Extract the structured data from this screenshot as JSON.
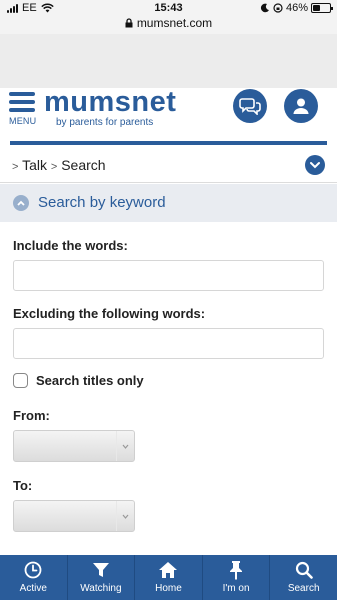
{
  "status_bar": {
    "carrier": "EE",
    "time": "15:43",
    "battery": "46%",
    "battery_level": 0.46
  },
  "browser": {
    "url": "mumsnet.com"
  },
  "header": {
    "menu_label": "MENU",
    "logo_word": "mumsnet",
    "tagline": "by parents for parents"
  },
  "breadcrumb": {
    "items": [
      "Talk",
      "Search"
    ],
    "separator": ">"
  },
  "search_section": {
    "title": "Search by keyword"
  },
  "form": {
    "include_label": "Include the words:",
    "include_value": "",
    "exclude_label": "Excluding the following words:",
    "exclude_value": "",
    "titles_only_label": "Search titles only",
    "titles_only_checked": false,
    "from_label": "From:",
    "from_value": "",
    "to_label": "To:",
    "to_value": ""
  },
  "bottom_nav": {
    "items": [
      {
        "label": "Active",
        "icon": "clock-icon"
      },
      {
        "label": "Watching",
        "icon": "filter-icon"
      },
      {
        "label": "Home",
        "icon": "home-icon"
      },
      {
        "label": "I'm on",
        "icon": "pin-icon"
      },
      {
        "label": "Search",
        "icon": "search-icon"
      }
    ]
  },
  "colors": {
    "brand": "#2a5c9a",
    "section_bg": "#e9ecf1",
    "status_bar_bg": "#f3f3f3"
  }
}
